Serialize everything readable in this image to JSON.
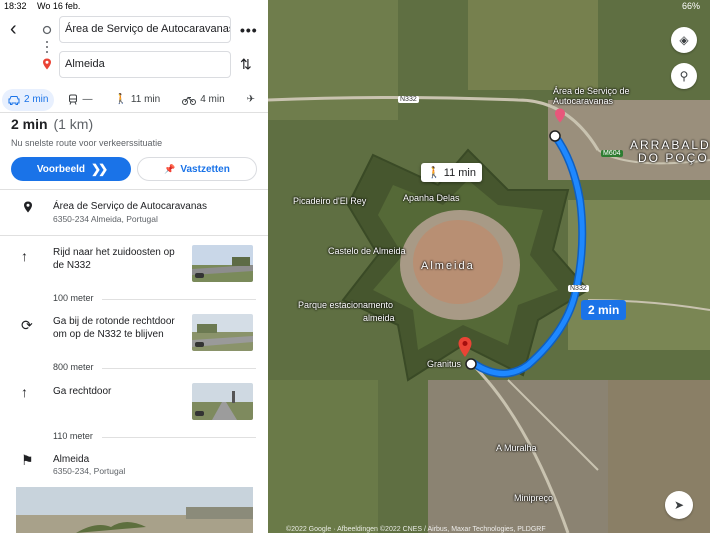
{
  "status": {
    "time": "18:32",
    "date": "Wo 16 feb.",
    "battery": "66%"
  },
  "search": {
    "origin": "Área de Serviço de Autocaravanas",
    "destination": "Almeida"
  },
  "modes": [
    {
      "icon": "car-icon",
      "label": "2 min",
      "active": true
    },
    {
      "icon": "train-icon",
      "label": "—",
      "active": false
    },
    {
      "icon": "walk-icon",
      "label": "11 min",
      "active": false
    },
    {
      "icon": "bike-icon",
      "label": "4 min",
      "active": false
    },
    {
      "icon": "flight-icon",
      "label": "",
      "active": false
    }
  ],
  "summary": {
    "time": "2 min",
    "distance": "(1 km)",
    "note": "Nu snelste route voor verkeerssituatie",
    "preview_label": "Voorbeeld",
    "pin_label": "Vastzetten"
  },
  "start": {
    "title": "Área de Serviço de Autocaravanas",
    "address": "6350-234 Almeida, Portugal"
  },
  "steps": [
    {
      "text": "Rijd naar het zuidoosten op de N332",
      "distance": "100 meter"
    },
    {
      "text": "Ga bij de rotonde rechtdoor om op de N332 te blijven",
      "distance": "800 meter"
    },
    {
      "text": "Ga rechtdoor",
      "distance": "110 meter"
    }
  ],
  "end": {
    "title": "Almeida",
    "address": "6350-234, Portugal"
  },
  "map": {
    "walk_chip": "11 min",
    "time_chip": "2 min",
    "labels": {
      "service_area": "Área de Serviço de Autocaravanas",
      "arrabalde_line1": "ARRABALDE",
      "arrabalde_line2": "DO POÇO",
      "picadeiro": "Picadeiro d'El Rey",
      "apanha": "Apanha Delas",
      "castelo": "Castelo de Almeida",
      "almeida": "Almeida",
      "parque_line1": "Parque estacionamento",
      "parque_line2": "almeida",
      "granitus": "Granitus",
      "muralha": "A Muralha",
      "minipreco": "Minipreço"
    },
    "roads": {
      "n332a": "N332",
      "n332b": "N332",
      "m604": "M604"
    },
    "copyright": "©2022 Google · Afbeeldingen ©2022 CNES / Airbus, Maxar Technologies, PLDGRF"
  },
  "colors": {
    "accent": "#1a73e8",
    "route": "#1e88ff",
    "destination": "#ea4335"
  }
}
